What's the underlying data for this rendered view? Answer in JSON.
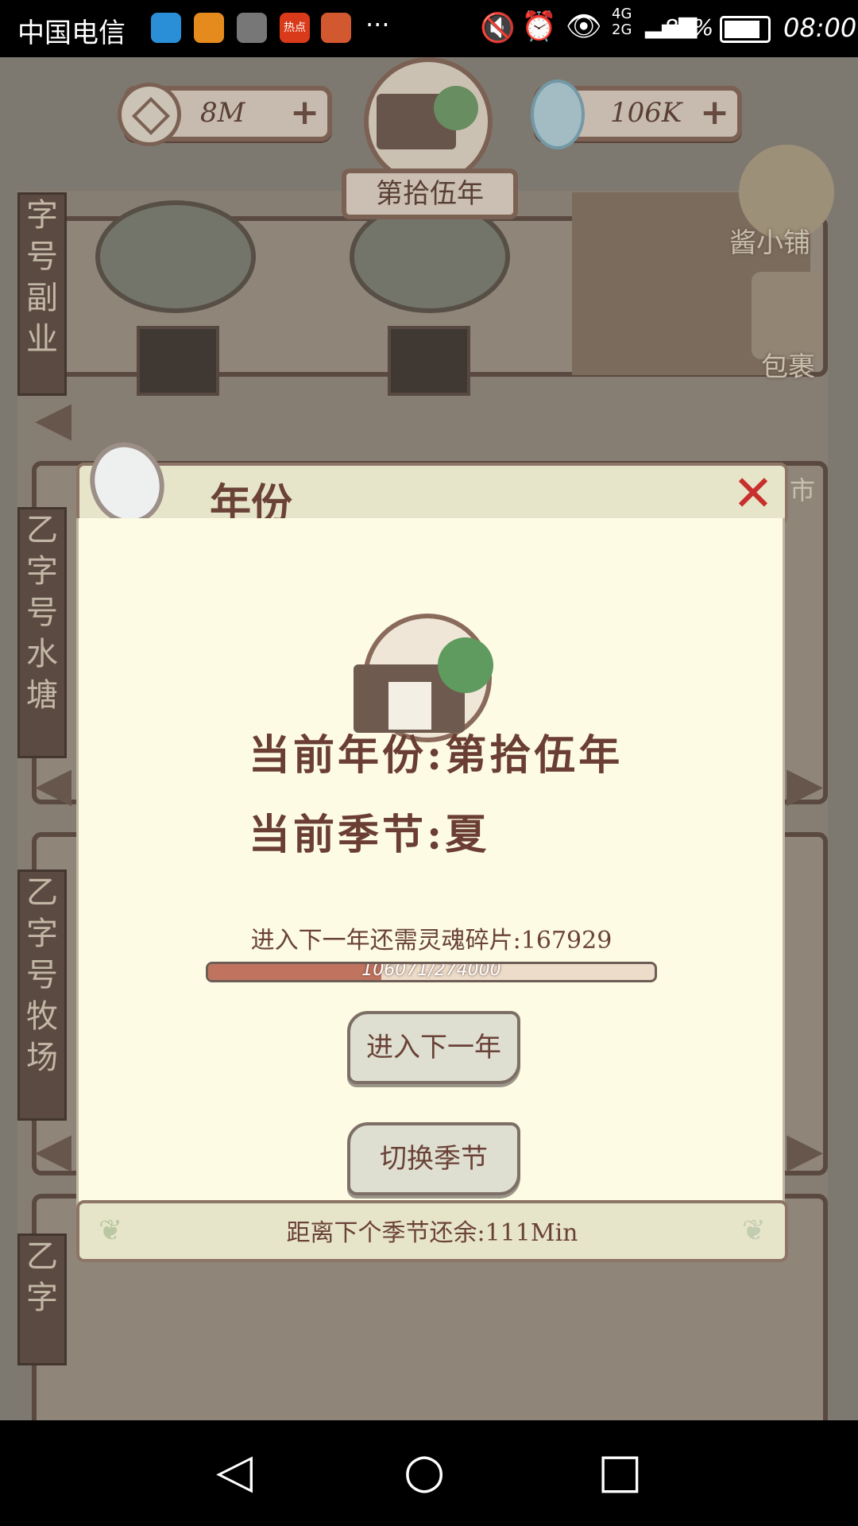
{
  "status_bar": {
    "carrier": "中国电信",
    "hot_badge": "热点",
    "more": "···",
    "network": "4G 2G",
    "battery": "86%",
    "time": "08:00"
  },
  "hud": {
    "coins": "8M",
    "souls": "106K",
    "year_banner": "第拾伍年",
    "plus": "+"
  },
  "side_labels": {
    "shop": "酱小铺",
    "bag": "包裹",
    "market": "市",
    "tab1": "字号副业",
    "tab2": "乙字号水塘",
    "tab3": "乙字号牧场",
    "tab4": "乙字"
  },
  "dialog": {
    "title": "年份",
    "close": "✕",
    "current_year_line": "当前年份:第拾伍年",
    "current_season_line": "当前季节:夏",
    "need_text": "进入下一年还需灵魂碎片:167929",
    "progress": {
      "current": 106071,
      "total": 274000,
      "label": "106071/274000"
    },
    "btn_next_year": "进入下一年",
    "btn_switch_season": "切换季节",
    "footer": "距离下个季节还余:111Min"
  },
  "nav": {
    "back": "◁",
    "home": "○",
    "recent": "□"
  }
}
